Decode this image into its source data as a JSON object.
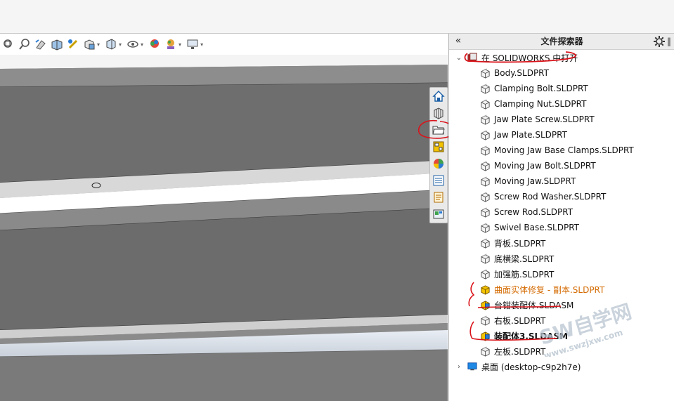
{
  "panel": {
    "title": "文件探索器",
    "collapse_glyph": "«",
    "pin_glyph": "‖"
  },
  "tree": {
    "root_open": {
      "label": "在 SOLIDWORKS 中打开",
      "expanded": true
    },
    "files": [
      {
        "label": "Body.SLDPRT",
        "kind": "part",
        "style": "normal"
      },
      {
        "label": "Clamping Bolt.SLDPRT",
        "kind": "part",
        "style": "normal"
      },
      {
        "label": "Clamping Nut.SLDPRT",
        "kind": "part",
        "style": "normal"
      },
      {
        "label": "Jaw Plate Screw.SLDPRT",
        "kind": "part",
        "style": "normal"
      },
      {
        "label": "Jaw Plate.SLDPRT",
        "kind": "part",
        "style": "normal"
      },
      {
        "label": "Moving Jaw Base Clamps.SLDPRT",
        "kind": "part",
        "style": "normal"
      },
      {
        "label": "Moving Jaw Bolt.SLDPRT",
        "kind": "part",
        "style": "normal"
      },
      {
        "label": "Moving Jaw.SLDPRT",
        "kind": "part",
        "style": "normal"
      },
      {
        "label": "Screw Rod Washer.SLDPRT",
        "kind": "part",
        "style": "normal"
      },
      {
        "label": "Screw Rod.SLDPRT",
        "kind": "part",
        "style": "normal"
      },
      {
        "label": "Swivel Base.SLDPRT",
        "kind": "part",
        "style": "normal"
      },
      {
        "label": "背板.SLDPRT",
        "kind": "part",
        "style": "normal"
      },
      {
        "label": "底横梁.SLDPRT",
        "kind": "part",
        "style": "normal"
      },
      {
        "label": "加强筋.SLDPRT",
        "kind": "part",
        "style": "normal"
      },
      {
        "label": "曲面实体修复 - 副本.SLDPRT",
        "kind": "part-active",
        "style": "orange"
      },
      {
        "label": "台钳装配体.SLDASM",
        "kind": "assembly",
        "style": "normal"
      },
      {
        "label": "右板.SLDPRT",
        "kind": "part",
        "style": "normal"
      },
      {
        "label": "装配体3.SLDASM",
        "kind": "assembly",
        "style": "bold"
      },
      {
        "label": "左板.SLDPRT",
        "kind": "part",
        "style": "normal"
      }
    ],
    "desktop": {
      "label": "桌面 (desktop-c9p2h7e)",
      "expanded": false
    }
  },
  "watermark": {
    "line1": "SW自学网",
    "line2": "www.swzjxw.com"
  },
  "toolbar_icons": [
    "zoom-fit-icon",
    "zoom-area-icon",
    "previous-view-icon",
    "section-view-icon",
    "view-orientation-icon",
    "display-style-icon",
    "hide-show-icon",
    "edit-appearance-icon",
    "apply-scene-icon",
    "view-settings-icon"
  ],
  "taskpane_tabs": [
    "home-icon",
    "design-library-icon",
    "file-explorer-icon",
    "view-palette-icon",
    "appearances-icon",
    "custom-properties-icon",
    "forum-icon",
    "solidworks-resources-icon"
  ],
  "colors": {
    "orange_text": "#d46a00",
    "annotation_red": "#d9141b",
    "viewport_gray": "#6f6f6f"
  }
}
